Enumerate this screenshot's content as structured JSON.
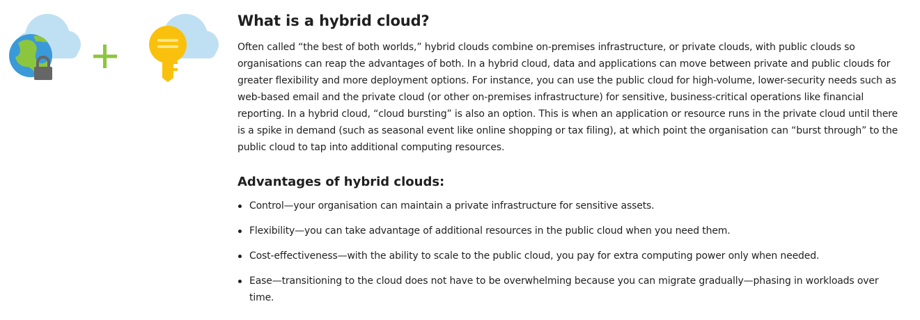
{
  "illustration": {
    "left_icon": "globe-with-padlock-cloud-icon",
    "operator_icon": "plus-icon",
    "right_icon": "key-cloud-icon",
    "colors": {
      "cloud": "#bfe0f2",
      "globe_blue": "#3a9ad9",
      "globe_green": "#8cc63f",
      "plus_green": "#8cc63f",
      "key_yellow": "#f9c10e",
      "lock_gray": "#666666"
    }
  },
  "article": {
    "title": "What is a hybrid cloud?",
    "paragraph": "Often called “the best of both worlds,” hybrid clouds combine on-premises infrastructure, or private clouds, with public clouds so organisations can reap the advantages of both. In a hybrid cloud, data and applications can move between private and public clouds for greater flexibility and more deployment options. For instance, you can use the public cloud for high-volume, lower-security needs such as web-based email and the private cloud (or other on-premises infrastructure) for sensitive, business-critical operations like financial reporting. In a hybrid cloud, “cloud bursting” is also an option. This is when an application or resource runs in the private cloud until there is a spike in demand (such as seasonal event like online shopping or tax filing), at which point the organisation can “burst through” to the public cloud to tap into additional computing resources.",
    "advantages_heading": "Advantages of hybrid clouds:",
    "advantages": [
      "Control—your organisation can maintain a private infrastructure for sensitive assets.",
      "Flexibility—you can take advantage of additional resources in the public cloud when you need them.",
      "Cost-effectiveness—with the ability to scale to the public cloud, you pay for extra computing power only when needed.",
      "Ease—transitioning to the cloud does not have to be overwhelming because you can migrate gradually—phasing in workloads over time."
    ]
  }
}
